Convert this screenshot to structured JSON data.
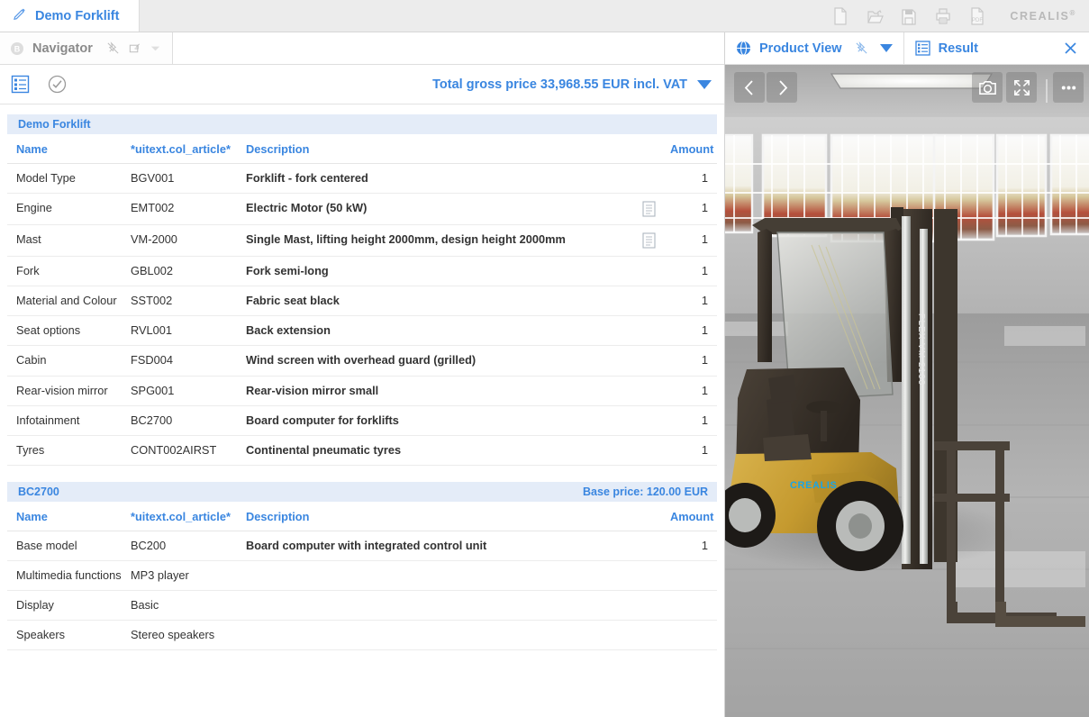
{
  "topbar": {
    "document_tab": {
      "label": "Demo Forklift",
      "icon": "pencil-icon"
    },
    "tools": [
      {
        "name": "new-document-icon",
        "label": "New"
      },
      {
        "name": "open-folder-icon",
        "label": "Open"
      },
      {
        "name": "save-icon",
        "label": "Save"
      },
      {
        "name": "print-icon",
        "label": "Print"
      },
      {
        "name": "export-pdf-icon",
        "label": "PDF"
      }
    ],
    "brand": "CREALIS",
    "brand_mark": "®"
  },
  "navigator": {
    "label": "Navigator",
    "icons": [
      "navigator-circle-icon",
      "unpin-icon",
      "restore-window-icon",
      "chevron-down-icon"
    ]
  },
  "toolbar": {
    "configuration_icon": "configuration-list-icon",
    "validate_icon": "check-circle-icon",
    "price_label": "Total gross price 33,968.55 EUR incl. VAT",
    "price_dropdown_icon": "triangle-down-icon"
  },
  "columns": {
    "name": "Name",
    "article": "*uitext.col_article*",
    "description": "Description",
    "amount": "Amount"
  },
  "groups": [
    {
      "title": "Demo Forklift",
      "price": "",
      "rows": [
        {
          "name": "Model Type",
          "article": "BGV001",
          "description": "Forklift - fork centered",
          "note": false,
          "amount": "1"
        },
        {
          "name": "Engine",
          "article": "EMT002",
          "description": "Electric Motor (50 kW)",
          "note": true,
          "amount": "1"
        },
        {
          "name": "Mast",
          "article": "VM-2000",
          "description": "Single Mast, lifting height 2000mm, design height 2000mm",
          "note": true,
          "amount": "1"
        },
        {
          "name": "Fork",
          "article": "GBL002",
          "description": "Fork semi-long",
          "note": false,
          "amount": "1"
        },
        {
          "name": "Material and Colour",
          "article": "SST002",
          "description": "Fabric seat black",
          "note": false,
          "amount": "1"
        },
        {
          "name": "Seat options",
          "article": "RVL001",
          "description": "Back extension",
          "note": false,
          "amount": "1"
        },
        {
          "name": "Cabin",
          "article": "FSD004",
          "description": "Wind screen with overhead guard (grilled)",
          "note": false,
          "amount": "1"
        },
        {
          "name": "Rear-vision mirror",
          "article": "SPG001",
          "description": "Rear-vision mirror small",
          "note": false,
          "amount": "1"
        },
        {
          "name": "Infotainment",
          "article": "BC2700",
          "description": "Board computer for forklifts",
          "note": false,
          "amount": "1"
        },
        {
          "name": "Tyres",
          "article": "CONT002AIRST",
          "description": "Continental pneumatic tyres",
          "note": false,
          "amount": "1"
        }
      ]
    },
    {
      "title": "BC2700",
      "price": "Base price: 120.00 EUR",
      "rows": [
        {
          "name": "Base model",
          "article": "BC200",
          "description": "Board computer with integrated control unit",
          "note": false,
          "amount": "1"
        },
        {
          "name": "Multimedia functions",
          "article": "MP3 player",
          "description": "",
          "note": false,
          "amount": ""
        },
        {
          "name": "Display",
          "article": "Basic",
          "description": "",
          "note": false,
          "amount": ""
        },
        {
          "name": "Speakers",
          "article": "Stereo speakers",
          "description": "",
          "note": false,
          "amount": ""
        }
      ]
    }
  ],
  "view_tabs": {
    "product_view": {
      "label": "Product View",
      "icon": "product-view-icon"
    },
    "product_view_pin": "unpin-icon",
    "product_view_caret": "triangle-down-icon",
    "result": {
      "label": "Result",
      "icon": "result-list-icon"
    },
    "close": "close-icon"
  },
  "viewer": {
    "prev_icon": "chevron-left-icon",
    "next_icon": "chevron-right-icon",
    "camera_icon": "camera-icon",
    "fullscreen_icon": "fullscreen-icon",
    "more_icon": "more-options-icon",
    "mast_label": "PLEX VM 2100",
    "body_brand": "CREALIS",
    "colors": {
      "body": "#c8a23c",
      "dark": "#3a332c",
      "brand_text": "#18a5e8",
      "wall": "#bdbdbd",
      "floor": "#a8a8a8"
    }
  }
}
